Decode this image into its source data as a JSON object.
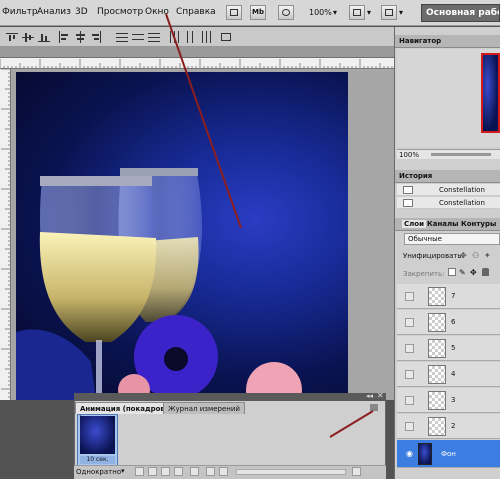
{
  "menubar": {
    "items": [
      "Фильтр",
      "Анализ",
      "3D",
      "Просмотр",
      "Окно",
      "Справка"
    ],
    "mb_label": "Mb",
    "zoom": "100%",
    "workspace": "Основная рабочая"
  },
  "navigator": {
    "title": "Навигатор",
    "zoom": "100%"
  },
  "history": {
    "title": "История",
    "items": [
      "Constellation",
      "Constellation"
    ]
  },
  "layers": {
    "tabs": [
      "Слои",
      "Каналы",
      "Контуры"
    ],
    "blend_mode": "Обычные",
    "unify_label": "Унифицировать:",
    "lock_label": "Закрепить:",
    "rows": [
      "7",
      "6",
      "5",
      "4",
      "3",
      "2",
      "Фон"
    ]
  },
  "animation": {
    "tabs": [
      "Анимация (покадровая)",
      "Журнал измерений"
    ],
    "frame_number": "1",
    "frame_time": "10 сек.",
    "loop": "Однократно"
  },
  "colors": {
    "accent": "#3b7de0",
    "arrow": "#8b1f1f"
  }
}
